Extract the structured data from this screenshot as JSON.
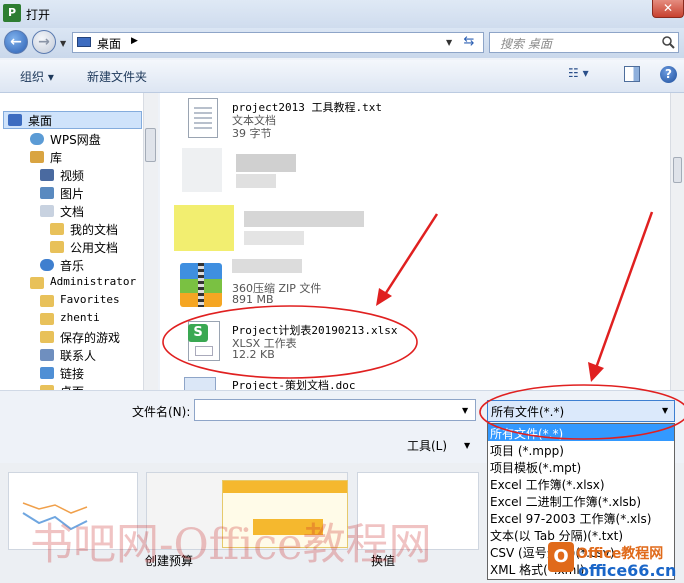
{
  "window": {
    "title": "打开",
    "app_icon_letter": "P",
    "close_glyph": "✕"
  },
  "address": {
    "location": "桌面",
    "separator": "▶",
    "search_placeholder": "搜索 桌面"
  },
  "toolbar": {
    "organize": "组织 ▾",
    "new_folder": "新建文件夹",
    "view_glyph": "☷ ▾"
  },
  "nav": {
    "items": [
      {
        "label": "桌面",
        "icon": "desktop-icon"
      },
      {
        "label": "WPS网盘",
        "icon": "cloud-icon"
      },
      {
        "label": "库",
        "icon": "library-icon"
      },
      {
        "label": "视频",
        "icon": "video-icon"
      },
      {
        "label": "图片",
        "icon": "picture-icon"
      },
      {
        "label": "文档",
        "icon": "document-icon"
      },
      {
        "label": "我的文档",
        "icon": "folder-icon"
      },
      {
        "label": "公用文档",
        "icon": "folder-icon"
      },
      {
        "label": "音乐",
        "icon": "music-icon"
      },
      {
        "label": "Administrator",
        "icon": "user-icon"
      },
      {
        "label": "Favorites",
        "icon": "folder-icon"
      },
      {
        "label": "zhenti",
        "icon": "folder-icon"
      },
      {
        "label": "保存的游戏",
        "icon": "folder-icon"
      },
      {
        "label": "联系人",
        "icon": "contacts-icon"
      },
      {
        "label": "链接",
        "icon": "links-icon"
      },
      {
        "label": "桌面",
        "icon": "folder-icon"
      }
    ]
  },
  "files": {
    "items": [
      {
        "name": "project2013 工具教程.txt",
        "type": "文本文档",
        "size": "39 字节"
      },
      {
        "name": "",
        "type": "360压缩 ZIP 文件",
        "size": "891 MB"
      },
      {
        "name": "Project计划表20190213.xlsx",
        "type": "XLSX 工作表",
        "size": "12.2 KB"
      },
      {
        "name": "Project-策划文档.doc",
        "type": "",
        "size": ""
      }
    ]
  },
  "bottom": {
    "filename_label": "文件名(N):",
    "filename_value": "",
    "filetype_selected": "所有文件(*.*)",
    "tools_label": "工具(L)"
  },
  "filetype_options": [
    "所有文件(*.*)",
    "项目 (*.mpp)",
    "项目模板(*.mpt)",
    "Excel 工作簿(*.xlsx)",
    "Excel 二进制工作簿(*.xlsb)",
    "Excel 97-2003 工作簿(*.xls)",
    "文本(以 Tab 分隔)(*.txt)",
    "CSV (逗号分隔)(*.csv)",
    "XML 格式(*.xml)"
  ],
  "background": {
    "label1": "创建预算",
    "label2": "换值",
    "watermark": "书吧网-Office教程网",
    "logo_text": "Office教程网",
    "logo_url": "office66.cn"
  },
  "colors": {
    "selection": "#3399ff",
    "annotation": "#e02020",
    "nav_selected": "#cfe3fb"
  }
}
